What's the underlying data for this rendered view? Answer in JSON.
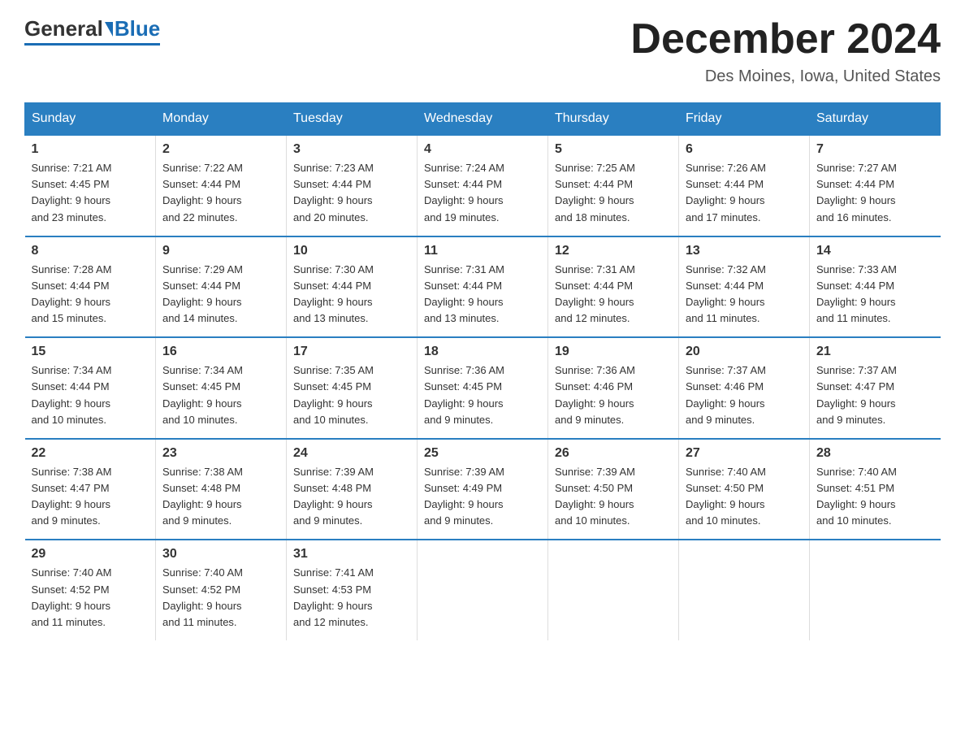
{
  "logo": {
    "general": "General",
    "triangle": "",
    "blue": "Blue"
  },
  "title": "December 2024",
  "subtitle": "Des Moines, Iowa, United States",
  "days_header": [
    "Sunday",
    "Monday",
    "Tuesday",
    "Wednesday",
    "Thursday",
    "Friday",
    "Saturday"
  ],
  "weeks": [
    [
      {
        "num": "1",
        "info": "Sunrise: 7:21 AM\nSunset: 4:45 PM\nDaylight: 9 hours\nand 23 minutes."
      },
      {
        "num": "2",
        "info": "Sunrise: 7:22 AM\nSunset: 4:44 PM\nDaylight: 9 hours\nand 22 minutes."
      },
      {
        "num": "3",
        "info": "Sunrise: 7:23 AM\nSunset: 4:44 PM\nDaylight: 9 hours\nand 20 minutes."
      },
      {
        "num": "4",
        "info": "Sunrise: 7:24 AM\nSunset: 4:44 PM\nDaylight: 9 hours\nand 19 minutes."
      },
      {
        "num": "5",
        "info": "Sunrise: 7:25 AM\nSunset: 4:44 PM\nDaylight: 9 hours\nand 18 minutes."
      },
      {
        "num": "6",
        "info": "Sunrise: 7:26 AM\nSunset: 4:44 PM\nDaylight: 9 hours\nand 17 minutes."
      },
      {
        "num": "7",
        "info": "Sunrise: 7:27 AM\nSunset: 4:44 PM\nDaylight: 9 hours\nand 16 minutes."
      }
    ],
    [
      {
        "num": "8",
        "info": "Sunrise: 7:28 AM\nSunset: 4:44 PM\nDaylight: 9 hours\nand 15 minutes."
      },
      {
        "num": "9",
        "info": "Sunrise: 7:29 AM\nSunset: 4:44 PM\nDaylight: 9 hours\nand 14 minutes."
      },
      {
        "num": "10",
        "info": "Sunrise: 7:30 AM\nSunset: 4:44 PM\nDaylight: 9 hours\nand 13 minutes."
      },
      {
        "num": "11",
        "info": "Sunrise: 7:31 AM\nSunset: 4:44 PM\nDaylight: 9 hours\nand 13 minutes."
      },
      {
        "num": "12",
        "info": "Sunrise: 7:31 AM\nSunset: 4:44 PM\nDaylight: 9 hours\nand 12 minutes."
      },
      {
        "num": "13",
        "info": "Sunrise: 7:32 AM\nSunset: 4:44 PM\nDaylight: 9 hours\nand 11 minutes."
      },
      {
        "num": "14",
        "info": "Sunrise: 7:33 AM\nSunset: 4:44 PM\nDaylight: 9 hours\nand 11 minutes."
      }
    ],
    [
      {
        "num": "15",
        "info": "Sunrise: 7:34 AM\nSunset: 4:44 PM\nDaylight: 9 hours\nand 10 minutes."
      },
      {
        "num": "16",
        "info": "Sunrise: 7:34 AM\nSunset: 4:45 PM\nDaylight: 9 hours\nand 10 minutes."
      },
      {
        "num": "17",
        "info": "Sunrise: 7:35 AM\nSunset: 4:45 PM\nDaylight: 9 hours\nand 10 minutes."
      },
      {
        "num": "18",
        "info": "Sunrise: 7:36 AM\nSunset: 4:45 PM\nDaylight: 9 hours\nand 9 minutes."
      },
      {
        "num": "19",
        "info": "Sunrise: 7:36 AM\nSunset: 4:46 PM\nDaylight: 9 hours\nand 9 minutes."
      },
      {
        "num": "20",
        "info": "Sunrise: 7:37 AM\nSunset: 4:46 PM\nDaylight: 9 hours\nand 9 minutes."
      },
      {
        "num": "21",
        "info": "Sunrise: 7:37 AM\nSunset: 4:47 PM\nDaylight: 9 hours\nand 9 minutes."
      }
    ],
    [
      {
        "num": "22",
        "info": "Sunrise: 7:38 AM\nSunset: 4:47 PM\nDaylight: 9 hours\nand 9 minutes."
      },
      {
        "num": "23",
        "info": "Sunrise: 7:38 AM\nSunset: 4:48 PM\nDaylight: 9 hours\nand 9 minutes."
      },
      {
        "num": "24",
        "info": "Sunrise: 7:39 AM\nSunset: 4:48 PM\nDaylight: 9 hours\nand 9 minutes."
      },
      {
        "num": "25",
        "info": "Sunrise: 7:39 AM\nSunset: 4:49 PM\nDaylight: 9 hours\nand 9 minutes."
      },
      {
        "num": "26",
        "info": "Sunrise: 7:39 AM\nSunset: 4:50 PM\nDaylight: 9 hours\nand 10 minutes."
      },
      {
        "num": "27",
        "info": "Sunrise: 7:40 AM\nSunset: 4:50 PM\nDaylight: 9 hours\nand 10 minutes."
      },
      {
        "num": "28",
        "info": "Sunrise: 7:40 AM\nSunset: 4:51 PM\nDaylight: 9 hours\nand 10 minutes."
      }
    ],
    [
      {
        "num": "29",
        "info": "Sunrise: 7:40 AM\nSunset: 4:52 PM\nDaylight: 9 hours\nand 11 minutes."
      },
      {
        "num": "30",
        "info": "Sunrise: 7:40 AM\nSunset: 4:52 PM\nDaylight: 9 hours\nand 11 minutes."
      },
      {
        "num": "31",
        "info": "Sunrise: 7:41 AM\nSunset: 4:53 PM\nDaylight: 9 hours\nand 12 minutes."
      },
      {
        "num": "",
        "info": ""
      },
      {
        "num": "",
        "info": ""
      },
      {
        "num": "",
        "info": ""
      },
      {
        "num": "",
        "info": ""
      }
    ]
  ]
}
